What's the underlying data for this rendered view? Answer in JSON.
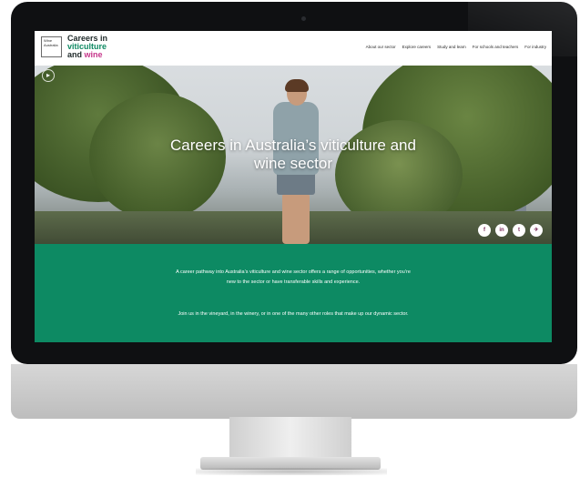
{
  "site": {
    "logo_text": "Wine Australia",
    "brand": {
      "line1": "Careers in",
      "line2": "viticulture",
      "line3a": "and",
      "line3b": "wine"
    }
  },
  "nav": [
    {
      "label": "About our sector"
    },
    {
      "label": "Explore careers"
    },
    {
      "label": "Study and learn"
    },
    {
      "label": "For schools and teachers"
    },
    {
      "label": "For industry"
    }
  ],
  "hero": {
    "title": "Careers in Australia’s viticulture and wine sector",
    "socials": [
      {
        "label": "f",
        "icon": "facebook-icon"
      },
      {
        "label": "in",
        "icon": "linkedin-icon"
      },
      {
        "label": "t",
        "icon": "twitter-icon"
      },
      {
        "label": "✈",
        "icon": "share-icon"
      }
    ]
  },
  "intro": {
    "paragraph1": "A career pathway into Australia’s viticulture and wine sector offers a range of opportunities, whether you’re new to the sector or have transferable skills and experience.",
    "paragraph2": "Join us in the vineyard, in the winery, or in one of the many other roles that make up our dynamic sector."
  },
  "colors": {
    "accent_green": "#0d8a63",
    "accent_pink": "#c6358a"
  }
}
